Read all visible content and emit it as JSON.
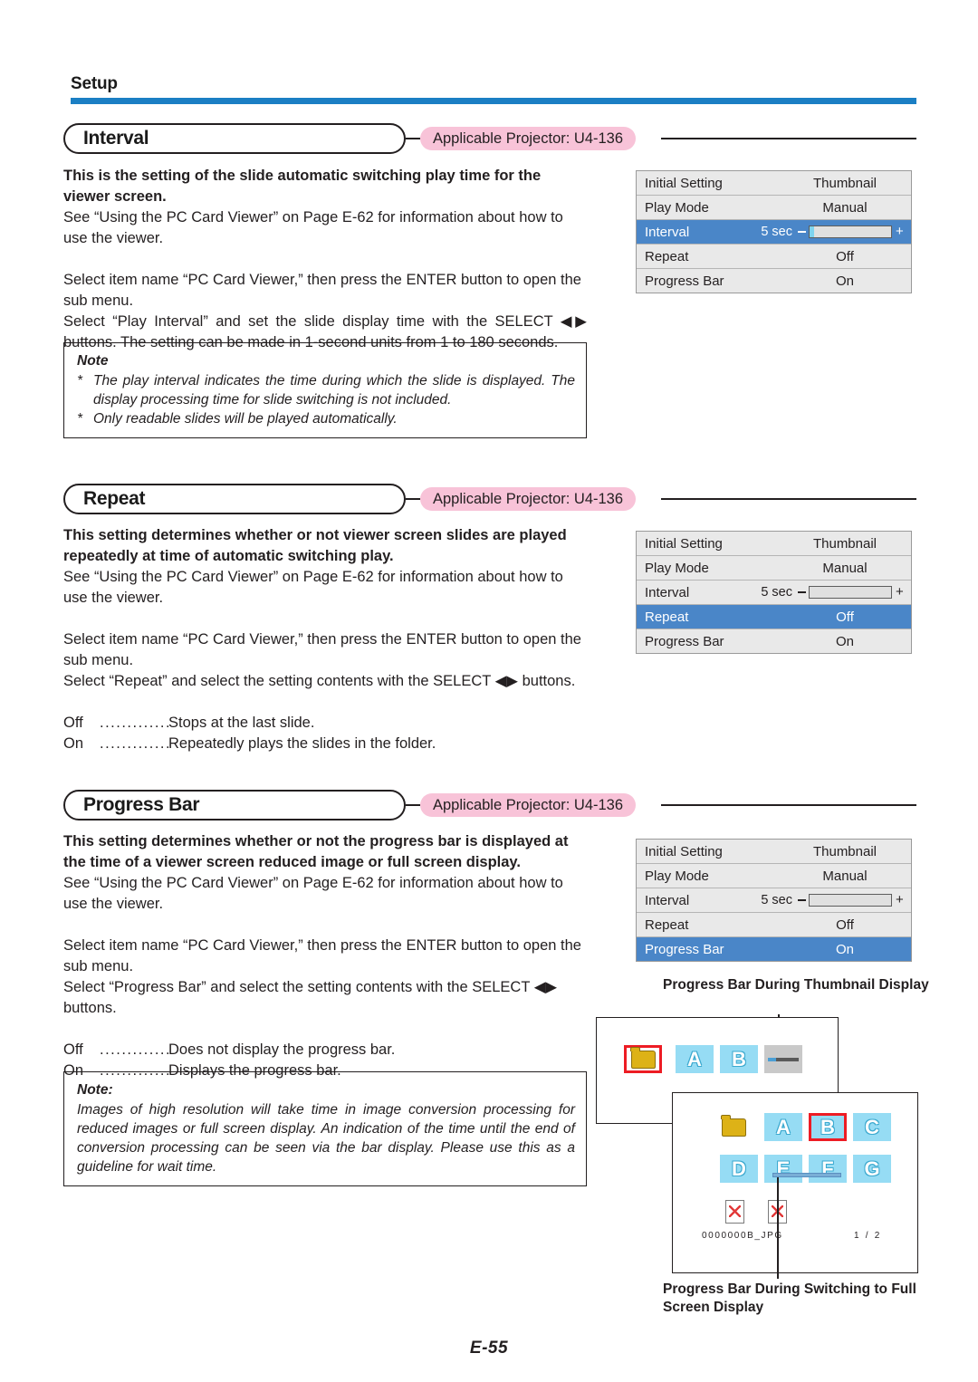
{
  "header": {
    "label": "Setup",
    "rule_color": "#1b7fc4"
  },
  "footer": {
    "page": "E-55"
  },
  "badge_text": "Applicable Projector: U4-136",
  "sections": [
    {
      "title": "Interval",
      "badge": "Applicable Projector: U4-136",
      "intro_bold": "This is the setting of the slide automatic switching play time for the viewer screen.",
      "intro_body": "See “Using the PC Card Viewer” on Page E-62 for information about how to use the viewer.",
      "para2": "Select item name “PC Card Viewer,” then press the ENTER button to open the sub menu.",
      "para3": "Select “Play Interval” and set the slide display time with the SELECT ◀▶ buttons. The setting can be made in 1-second units from 1 to 180 seconds.",
      "note": {
        "title": "Note",
        "items": [
          "The play interval indicates the time during which the slide is displayed. The display processing time for slide switching is not included.",
          "Only readable slides will be played automatically."
        ]
      }
    },
    {
      "title": "Repeat",
      "badge": "Applicable Projector: U4-136",
      "intro_bold": "This setting determines whether or not viewer screen slides are played repeatedly at time of automatic switching play.",
      "intro_body": "See “Using the PC Card Viewer” on Page E-62 for information about how to use the viewer.",
      "para2": "Select item name “PC Card Viewer,” then press the ENTER button to open the sub menu.",
      "para3": "Select “Repeat” and select the setting contents with the SELECT ◀▶ buttons.",
      "definitions": [
        {
          "key": "Off",
          "dots": "..............",
          "value": "Stops at the last slide."
        },
        {
          "key": "On",
          "dots": "...............",
          "value": "Repeatedly plays the slides in the folder."
        }
      ]
    },
    {
      "title": "Progress Bar",
      "badge": "Applicable Projector: U4-136",
      "intro_bold": "This setting determines whether or not the progress bar is displayed at the time of a viewer screen reduced image or full screen display.",
      "intro_body": "See “Using the PC Card Viewer” on Page E-62 for information about how to use the viewer.",
      "para2": "Select item name “PC Card Viewer,” then press the ENTER button to open the sub menu.",
      "para3": "Select “Progress Bar” and select the setting contents with the SELECT ◀▶ buttons.",
      "definitions": [
        {
          "key": "Off",
          "dots": "..............",
          "value": "Does not display the progress bar."
        },
        {
          "key": "On",
          "dots": "...............",
          "value": "Displays the progress bar."
        }
      ],
      "note": {
        "title": "Note:",
        "text": "Images of high resolution will take time in image conversion processing for reduced images or full screen display. An indication of the time until the end of conversion processing can be seen via the bar display. Please use this as a guideline for wait time."
      }
    }
  ],
  "osd_menus": [
    {
      "selected": "Interval",
      "rows": [
        {
          "label": "Initial Setting",
          "value": "Thumbnail",
          "type": "value"
        },
        {
          "label": "Play Mode",
          "value": "Manual",
          "type": "value"
        },
        {
          "label": "Interval",
          "value": "5 sec",
          "type": "slider",
          "slider_percent": 6,
          "minus": "−",
          "plus": "+"
        },
        {
          "label": "Repeat",
          "value": "Off",
          "type": "value"
        },
        {
          "label": "Progress Bar",
          "value": "On",
          "type": "value"
        }
      ]
    },
    {
      "selected": "Repeat",
      "rows": [
        {
          "label": "Initial Setting",
          "value": "Thumbnail",
          "type": "value"
        },
        {
          "label": "Play Mode",
          "value": "Manual",
          "type": "value"
        },
        {
          "label": "Interval",
          "value": "5 sec",
          "type": "slider",
          "slider_percent": 0,
          "minus": "−",
          "plus": "+"
        },
        {
          "label": "Repeat",
          "value": "Off",
          "type": "value"
        },
        {
          "label": "Progress Bar",
          "value": "On",
          "type": "value"
        }
      ]
    },
    {
      "selected": "Progress Bar",
      "rows": [
        {
          "label": "Initial Setting",
          "value": "Thumbnail",
          "type": "value"
        },
        {
          "label": "Play Mode",
          "value": "Manual",
          "type": "value"
        },
        {
          "label": "Interval",
          "value": "5 sec",
          "type": "slider",
          "slider_percent": 0,
          "minus": "−",
          "plus": "+"
        },
        {
          "label": "Repeat",
          "value": "Off",
          "type": "value"
        },
        {
          "label": "Progress Bar",
          "value": "On",
          "type": "value"
        }
      ]
    }
  ],
  "diagram": {
    "caption_top": "Progress Bar During Thumbnail Display",
    "caption_bottom": "Progress Bar During Switching to Full Screen Display",
    "thumbnail_screen": {
      "items": [
        "folder",
        "A",
        "B",
        "loading"
      ],
      "selected": "folder"
    },
    "fullscreen_screen": {
      "row1": [
        "folder",
        "A",
        "B",
        "C"
      ],
      "row2": [
        "D",
        "E",
        "F",
        "G"
      ],
      "selected": "B",
      "filename": "0000000B_JPG",
      "page_indicator": "1 /  2"
    },
    "colors": {
      "tile": "#96dcf4",
      "selection": "#ed1c24",
      "folder": "#ddb217",
      "progress": "#4b9fd5"
    }
  }
}
